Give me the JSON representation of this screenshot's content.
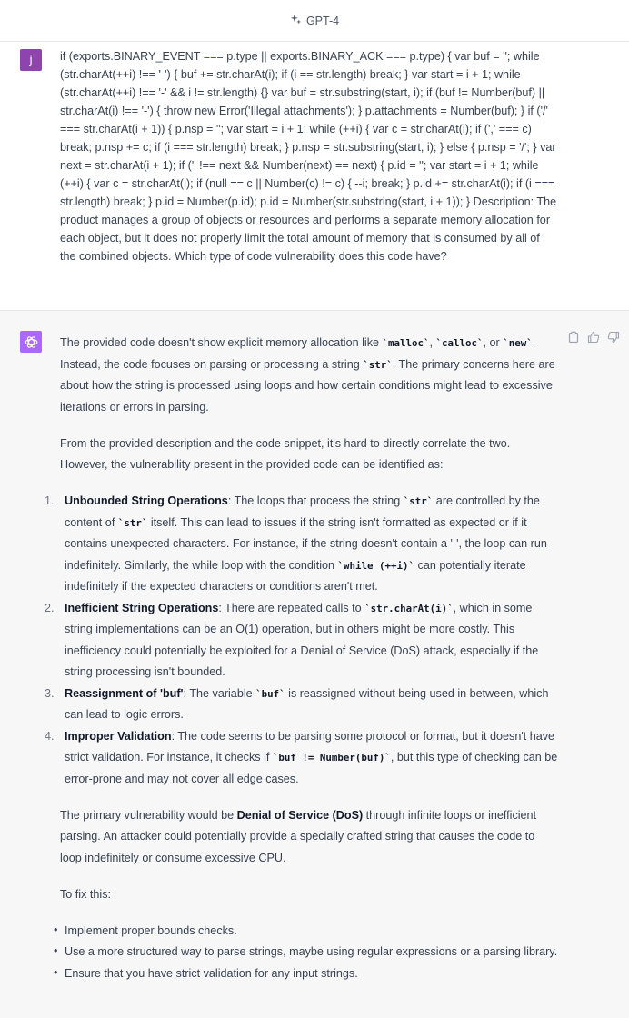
{
  "header": {
    "title": "GPT-4",
    "icon": "sparkle-icon"
  },
  "user_message": {
    "avatar_letter": "j",
    "text": "if (exports.BINARY_EVENT === p.type || exports.BINARY_ACK === p.type) { var buf = ''; while (str.charAt(++i) !== '-') { buf += str.charAt(i); if (i == str.length) break; } var start = i + 1; while (str.charAt(++i) !== '-' && i != str.length) {} var buf = str.substring(start, i); if (buf != Number(buf) || str.charAt(i) !== '-') { throw new Error('Illegal attachments'); } p.attachments = Number(buf); } if ('/' === str.charAt(i + 1)) { p.nsp = ''; var start = i + 1; while (++i) { var c = str.charAt(i); if (',' === c) break; p.nsp += c; if (i === str.length) break; } p.nsp = str.substring(start, i); } else { p.nsp = '/'; } var next = str.charAt(i + 1); if ('' !== next && Number(next) == next) { p.id = ''; var start = i + 1; while (++i) { var c = str.charAt(i); if (null == c || Number(c) != c) { --i; break; } p.id += str.charAt(i); if (i === str.length) break; } p.id = Number(p.id); p.id = Number(str.substring(start, i + 1)); } Description: The product manages a group of objects or resources and performs a separate memory allocation for each object, but it does not properly limit the total amount of memory that is consumed by all of the combined objects.  Which type of code vulnerability does this code have?"
  },
  "assistant_message": {
    "actions": [
      "clipboard-icon",
      "thumbs-up-icon",
      "thumbs-down-icon"
    ],
    "p1": {
      "t1": "The provided code doesn't show explicit memory allocation like ",
      "c1": "`malloc`",
      "t2": ", ",
      "c2": "`calloc`",
      "t3": ", or ",
      "c3": "`new`",
      "t4": ". Instead, the code focuses on parsing or processing a string ",
      "c4": "`str`",
      "t5": ". The primary concerns here are about how the string is processed using loops and how certain conditions might lead to excessive iterations or errors in parsing."
    },
    "p2": "From the provided description and the code snippet, it's hard to directly correlate the two. However, the vulnerability present in the provided code can be identified as:",
    "list": [
      {
        "num": "1.",
        "title": "Unbounded String Operations",
        "t1": ": The loops that process the string ",
        "c1": "`str`",
        "t2": " are controlled by the content of ",
        "c2": "`str`",
        "t3": " itself. This can lead to issues if the string isn't formatted as expected or if it contains unexpected characters. For instance, if the string doesn't contain a '-', the loop can run indefinitely. Similarly, the while loop with the condition ",
        "c3": "`while (++i)`",
        "t4": " can potentially iterate indefinitely if the expected characters or conditions aren't met."
      },
      {
        "num": "2.",
        "title": "Inefficient String Operations",
        "t1": ": There are repeated calls to ",
        "c1": "`str.charAt(i)`",
        "t2": ", which in some string implementations can be an O(1) operation, but in others might be more costly. This inefficiency could potentially be exploited for a Denial of Service (DoS) attack, especially if the string processing isn't bounded."
      },
      {
        "num": "3.",
        "title": "Reassignment of 'buf'",
        "t1": ": The variable ",
        "c1": "`buf`",
        "t2": " is reassigned without being used in between, which can lead to logic errors."
      },
      {
        "num": "4.",
        "title": "Improper Validation",
        "t1": ": The code seems to be parsing some protocol or format, but it doesn't have strict validation. For instance, it checks if ",
        "c1": "`buf != Number(buf)`",
        "t2": ", but this type of checking can be error-prone and may not cover all edge cases."
      }
    ],
    "p3": {
      "t1": "The primary vulnerability would be ",
      "b1": "Denial of Service (DoS)",
      "t2": " through infinite loops or inefficient parsing. An attacker could potentially provide a specially crafted string that causes the code to loop indefinitely or consume excessive CPU."
    },
    "p4": "To fix this:",
    "bullet": "•",
    "bullets": [
      "Implement proper bounds checks.",
      "Use a more structured way to parse strings, maybe using regular expressions or a parsing library.",
      "Ensure that you have strict validation for any input strings."
    ]
  }
}
